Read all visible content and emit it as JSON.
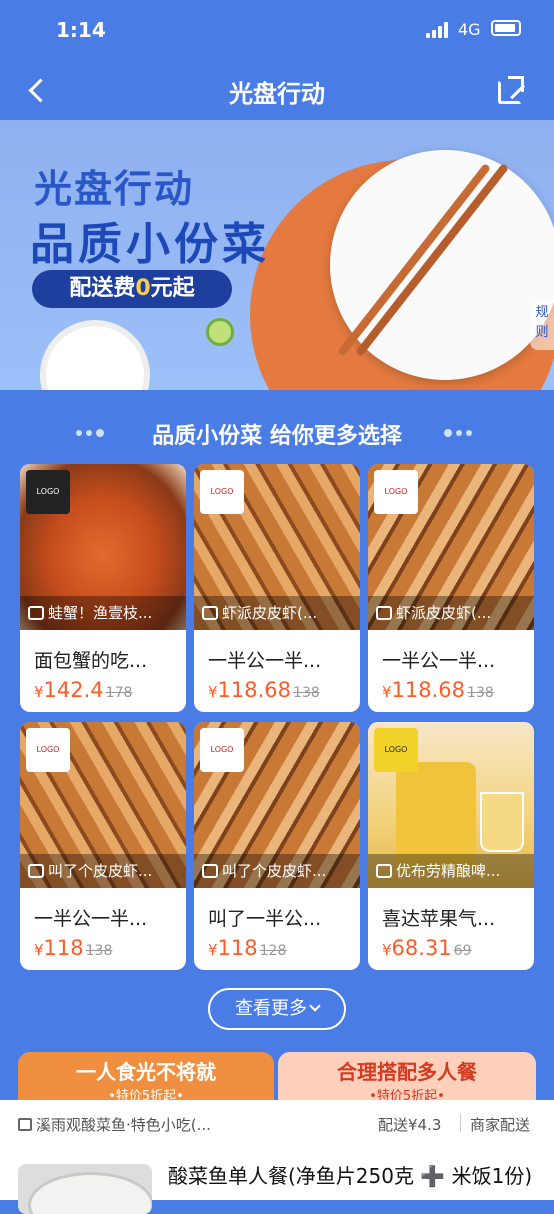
{
  "status": {
    "time": "1:14",
    "network": "4G"
  },
  "nav": {
    "title": "光盘行动"
  },
  "banner": {
    "line1": "光盘行动",
    "line2": "品质小份菜",
    "pill_prefix": "配送费",
    "pill_zero": "0",
    "pill_suffix": "元起",
    "rules_label": "规则"
  },
  "section": {
    "title": "品质小份菜  给你更多选择"
  },
  "products": [
    {
      "shop": "蛙蟹！渔壹枝...",
      "name": "面包蟹的吃...",
      "yen": "¥",
      "price": "142.4",
      "original": "178"
    },
    {
      "shop": "虾派皮皮虾(...",
      "name": "一半公一半...",
      "yen": "¥",
      "price": "118.68",
      "original": "138"
    },
    {
      "shop": "虾派皮皮虾(...",
      "name": "一半公一半...",
      "yen": "¥",
      "price": "118.68",
      "original": "138"
    },
    {
      "shop": "叫了个皮皮虾...",
      "name": "一半公一半...",
      "yen": "¥",
      "price": "118",
      "original": "138"
    },
    {
      "shop": "叫了个皮皮虾...",
      "name": "叫了一半公...",
      "yen": "¥",
      "price": "118",
      "original": "128"
    },
    {
      "shop": "优布劳精酿啤...",
      "name": "喜达苹果气...",
      "yen": "¥",
      "price": "68.31",
      "original": "69"
    }
  ],
  "more_button": "查看更多",
  "tabs": [
    {
      "title": "一人食光不将就",
      "sub": "•特价5折起•"
    },
    {
      "title": "合理搭配多人餐",
      "sub": "•特价5折起•"
    }
  ],
  "store": {
    "name": "溪雨观酸菜鱼·特色小吃(...",
    "fee": "配送¥4.3",
    "delivery": "商家配送",
    "dish": "酸菜鱼单人餐(净鱼片250克 ➕ 米饭1份)"
  }
}
